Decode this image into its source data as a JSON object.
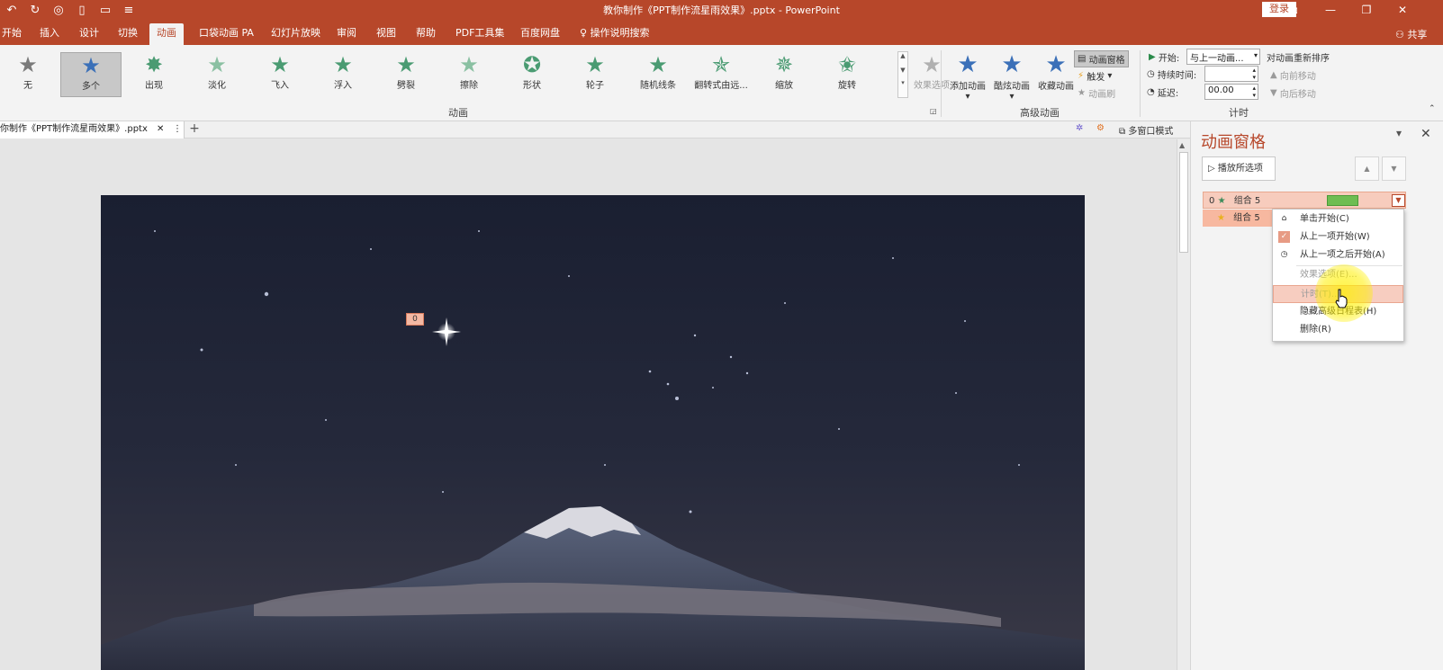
{
  "titlebar": {
    "title": "教你制作《PPT制作流星雨效果》.pptx  -  PowerPoint",
    "login": "登录"
  },
  "tabs": [
    {
      "label": "开始"
    },
    {
      "label": "插入"
    },
    {
      "label": "设计"
    },
    {
      "label": "切换"
    },
    {
      "label": "动画"
    },
    {
      "label": "口袋动画 PA"
    },
    {
      "label": "幻灯片放映"
    },
    {
      "label": "审阅"
    },
    {
      "label": "视图"
    },
    {
      "label": "帮助"
    },
    {
      "label": "PDF工具集"
    },
    {
      "label": "百度网盘"
    },
    {
      "label": "操作说明搜索"
    }
  ],
  "share_label": "共享",
  "gallery": {
    "items": [
      {
        "label": "无",
        "color": "#7a7a7a"
      },
      {
        "label": "多个",
        "color": "#3b70b8"
      },
      {
        "label": "出现",
        "color": "#4a9b72"
      },
      {
        "label": "淡化",
        "color": "#8ac0a2"
      },
      {
        "label": "飞入",
        "color": "#4a9b72"
      },
      {
        "label": "浮入",
        "color": "#4a9b72"
      },
      {
        "label": "劈裂",
        "color": "#4a9b72"
      },
      {
        "label": "擦除",
        "color": "#8ac0a2"
      },
      {
        "label": "形状",
        "color": "#4a9b72"
      },
      {
        "label": "轮子",
        "color": "#4a9b72"
      },
      {
        "label": "随机线条",
        "color": "#4a9b72"
      },
      {
        "label": "翻转式由远...",
        "color": "#4a9b72"
      },
      {
        "label": "缩放",
        "color": "#4a9b72"
      },
      {
        "label": "旋转",
        "color": "#4a9b72"
      }
    ],
    "effect_options": "效果选项",
    "group_label": "动画"
  },
  "advanced": {
    "add_animation": "添加动画",
    "painter_animation": "酷炫动画",
    "fav_animation": "收藏动画",
    "animation_pane": "动画窗格",
    "trigger": "触发",
    "anim_brush": "动画刷",
    "group_label": "高级动画"
  },
  "timing": {
    "start_label": "开始:",
    "start_value": "与上一动画...",
    "duration_label": "持续时间:",
    "duration_value": "",
    "delay_label": "延迟:",
    "delay_value": "00.00",
    "reorder_label": "对动画重新排序",
    "move_earlier": "向前移动",
    "move_later": "向后移动",
    "group_label": "计时"
  },
  "docbar": {
    "tab_title": "你制作《PPT制作流星雨效果》.pptx",
    "multiwindow": "多窗口模式"
  },
  "slide": {
    "anim_tag": "0"
  },
  "pane": {
    "title": "动画窗格",
    "play_btn": "播放所选项",
    "row1_index": "0",
    "row1_label": "组合 5",
    "row2_label": "组合 5"
  },
  "context_menu": {
    "items": [
      {
        "label": "单击开始(C)"
      },
      {
        "label": "从上一项开始(W)"
      },
      {
        "label": "从上一项之后开始(A)"
      },
      {
        "label": "效果选项(E)..."
      },
      {
        "label": "计时(T)..."
      },
      {
        "label": "隐藏高级日程表(H)"
      },
      {
        "label": "删除(R)"
      }
    ]
  },
  "colors": {
    "accent": "#b7472a",
    "ribbon_bg": "#f3f3f3",
    "selection": "#f7ccbd",
    "timeline_bar": "#6ebd52"
  }
}
